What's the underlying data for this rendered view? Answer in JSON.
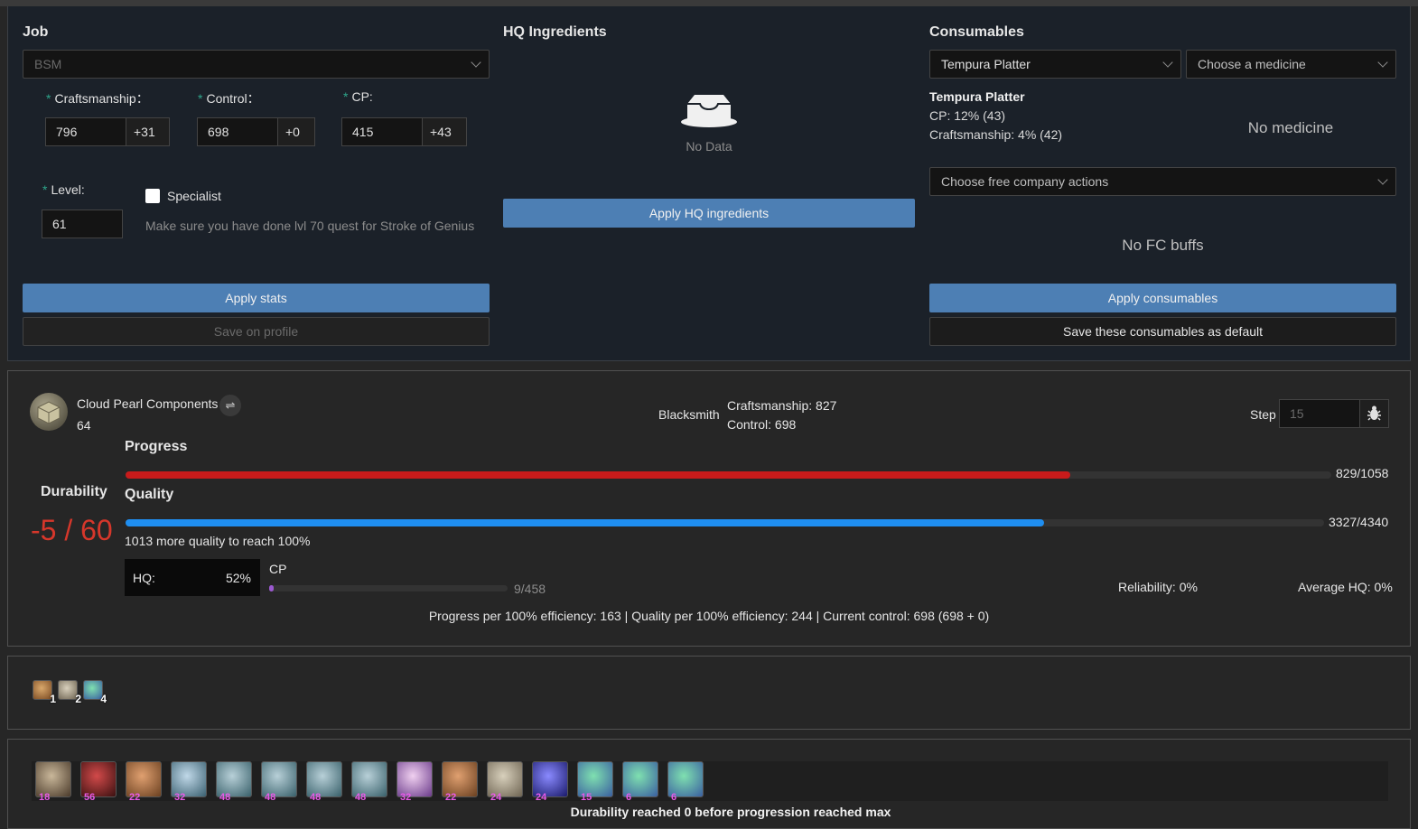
{
  "job": {
    "title": "Job",
    "selected": "BSM",
    "craftsmanship_label": "Craftsmanship：",
    "craftsmanship": "796",
    "craftsmanship_bonus": "+31",
    "control_label": "Control：",
    "control": "698",
    "control_bonus": "+0",
    "cp_label": "CP:",
    "cp": "415",
    "cp_bonus": "+43",
    "level_label": "Level:",
    "level": "61",
    "specialist_label": "Specialist",
    "hint": "Make sure you have done lvl 70 quest for Stroke of Genius",
    "apply_label": "Apply stats",
    "save_label": "Save on profile"
  },
  "hq": {
    "title": "HQ Ingredients",
    "empty": "No Data",
    "apply_label": "Apply HQ ingredients"
  },
  "consumables": {
    "title": "Consumables",
    "food": "Tempura Platter",
    "medicine_placeholder": "Choose a medicine",
    "food_name": "Tempura Platter",
    "food_line1": "CP: 12% (43)",
    "food_line2": "Craftsmanship: 4% (42)",
    "no_medicine": "No medicine",
    "fc_placeholder": "Choose free company actions",
    "no_fc": "No FC buffs",
    "apply_label": "Apply consumables",
    "save_label": "Save these consumables as default"
  },
  "sim": {
    "item_name": "Cloud Pearl Components",
    "item_level": "64",
    "job": "Blacksmith",
    "craftsmanship": "Craftsmanship: 827",
    "control": "Control: 698",
    "step_label": "Step",
    "step_placeholder": "15",
    "progress_label": "Progress",
    "progress_value": "829/1058",
    "progress_ratio": 0.7836,
    "quality_label": "Quality",
    "quality_value": "3327/4340",
    "quality_ratio": 0.7666,
    "quality_hint": "1013 more quality to reach 100%",
    "durability_label": "Durability",
    "durability_value": "-5 / 60",
    "hq_label": "HQ:",
    "hq_value": "52%",
    "cp_label": "CP",
    "cp_value": "9/458",
    "cp_ratio": 0.0197,
    "reliability": "Reliability: 0%",
    "average_hq": "Average HQ: 0%",
    "summary": "Progress per 100% efficiency: 163 | Quality per 100% efficiency: 244 | Current control: 698 (698 + 0)"
  },
  "buffs": [
    {
      "icon": "inner-quiet-icon",
      "count": "1"
    },
    {
      "icon": "waste-not-icon",
      "count": "2"
    },
    {
      "icon": "innovation-icon",
      "count": "4"
    }
  ],
  "actions": [
    {
      "icon": "muscle-memory-icon",
      "cost": "18"
    },
    {
      "icon": "manipulation-icon",
      "cost": "56"
    },
    {
      "icon": "basic-touch-icon",
      "cost": "22"
    },
    {
      "icon": "groundwork-icon",
      "cost": "32"
    },
    {
      "icon": "preparatory-touch-icon",
      "cost": "48"
    },
    {
      "icon": "preparatory-touch-icon",
      "cost": "48"
    },
    {
      "icon": "preparatory-touch-icon",
      "cost": "48"
    },
    {
      "icon": "preparatory-touch-icon",
      "cost": "48"
    },
    {
      "icon": "great-strides-icon",
      "cost": "32"
    },
    {
      "icon": "basic-touch-icon",
      "cost": "22"
    },
    {
      "icon": "waste-not-icon",
      "cost": "24"
    },
    {
      "icon": "byregots-blessing-icon",
      "cost": "24"
    },
    {
      "icon": "innovation-icon",
      "cost": "15"
    },
    {
      "icon": "innovation-icon",
      "cost": "6"
    },
    {
      "icon": "innovation-icon",
      "cost": "6"
    }
  ],
  "status_message": "Durability reached 0 before progression reached max",
  "colors": {
    "accent": "#4d7fb4",
    "progress": "#c71b1b",
    "quality": "#1f8ef0",
    "cp": "#9b59d0",
    "durability": "#d6372b"
  }
}
